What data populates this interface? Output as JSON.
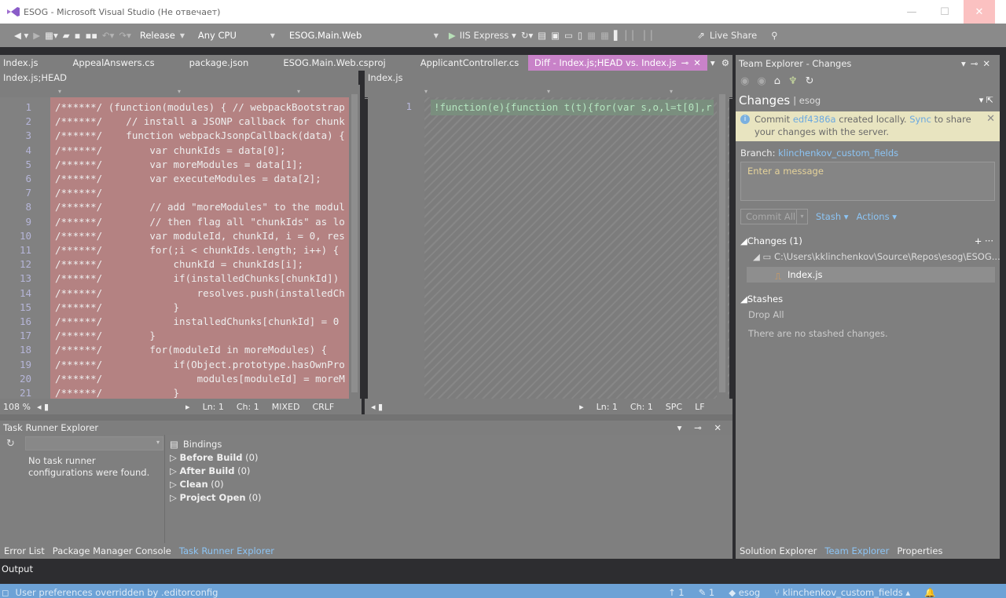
{
  "window": {
    "title": "ESOG - Microsoft Visual Studio (Не отвечает)"
  },
  "toolbar": {
    "config": "Release",
    "platform": "Any CPU",
    "startup_project": "ESOG.Main.Web",
    "run_target": "IIS Express",
    "live_share": "Live Share"
  },
  "doc_tabs": [
    {
      "label": "Index.js"
    },
    {
      "label": "AppealAnswers.cs"
    },
    {
      "label": "package.json"
    },
    {
      "label": "ESOG.Main.Web.csproj"
    },
    {
      "label": "ApplicantController.cs"
    },
    {
      "label": "Diff - Index.js;HEAD vs. Index.js"
    }
  ],
  "diff": {
    "left_file": "Index.js;HEAD",
    "right_file": "Index.js",
    "left_lines": [
      {
        "n": "1",
        "t": "/******/ (function(modules) { // webpackBootstrap"
      },
      {
        "n": "2",
        "t": "/******/    // install a JSONP callback for chunk"
      },
      {
        "n": "3",
        "t": "/******/    function webpackJsonpCallback(data) {"
      },
      {
        "n": "4",
        "t": "/******/        var chunkIds = data[0];"
      },
      {
        "n": "5",
        "t": "/******/        var moreModules = data[1];"
      },
      {
        "n": "6",
        "t": "/******/        var executeModules = data[2];"
      },
      {
        "n": "7",
        "t": "/******/"
      },
      {
        "n": "8",
        "t": "/******/        // add \"moreModules\" to the modul"
      },
      {
        "n": "9",
        "t": "/******/        // then flag all \"chunkIds\" as lo"
      },
      {
        "n": "10",
        "t": "/******/        var moduleId, chunkId, i = 0, res"
      },
      {
        "n": "11",
        "t": "/******/        for(;i < chunkIds.length; i++) {"
      },
      {
        "n": "12",
        "t": "/******/            chunkId = chunkIds[i];"
      },
      {
        "n": "13",
        "t": "/******/            if(installedChunks[chunkId])"
      },
      {
        "n": "14",
        "t": "/******/                resolves.push(installedCh"
      },
      {
        "n": "15",
        "t": "/******/            }"
      },
      {
        "n": "16",
        "t": "/******/            installedChunks[chunkId] = 0"
      },
      {
        "n": "17",
        "t": "/******/        }"
      },
      {
        "n": "18",
        "t": "/******/        for(moduleId in moreModules) {"
      },
      {
        "n": "19",
        "t": "/******/            if(Object.prototype.hasOwnPro"
      },
      {
        "n": "20",
        "t": "/******/                modules[moduleId] = moreM"
      },
      {
        "n": "21",
        "t": "/******/            }"
      }
    ],
    "right_line_num": "1",
    "right_line": "!function(e){function t(t){for(var s,o,l=t[0],r",
    "left_status": {
      "zoom": "108 %",
      "ln": "Ln: 1",
      "ch": "Ch: 1",
      "indent": "MIXED",
      "eol": "CRLF"
    },
    "right_status": {
      "ln": "Ln: 1",
      "ch": "Ch: 1",
      "indent": "SPC",
      "eol": "LF"
    }
  },
  "task_runner": {
    "title": "Task Runner Explorer",
    "message": "No task runner configurations were found.",
    "bindings_label": "Bindings",
    "bindings": [
      {
        "name": "Before Build",
        "count": "(0)"
      },
      {
        "name": "After Build",
        "count": "(0)"
      },
      {
        "name": "Clean",
        "count": "(0)"
      },
      {
        "name": "Project Open",
        "count": "(0)"
      }
    ]
  },
  "bottom_tabs": [
    "Error List",
    "Package Manager Console",
    "Task Runner Explorer"
  ],
  "output_label": "Output",
  "team_explorer": {
    "title": "Team Explorer - Changes",
    "section": "Changes",
    "repo": "esog",
    "notice_prefix": "Commit",
    "notice_commit": "edf4386a",
    "notice_mid": "created locally.",
    "notice_sync": "Sync",
    "notice_suffix": "to share your changes with the server.",
    "branch_label": "Branch:",
    "branch": "klinchenkov_custom_fields",
    "message_placeholder": "Enter a message",
    "commit_all": "Commit All",
    "stash": "Stash",
    "actions": "Actions",
    "changes_header": "Changes (1)",
    "path": "C:\\Users\\kklinchenkov\\Source\\Repos\\esog\\ESOG...",
    "file": "Index.js",
    "stashes_header": "Stashes",
    "drop_all": "Drop All",
    "no_stashes": "There are no stashed changes."
  },
  "right_tabs": [
    "Solution Explorer",
    "Team Explorer",
    "Properties"
  ],
  "statusbar": {
    "message": "User preferences overridden by .editorconfig",
    "up": "1",
    "pencil": "1",
    "repo": "esog",
    "branch": "klinchenkov_custom_fields"
  }
}
